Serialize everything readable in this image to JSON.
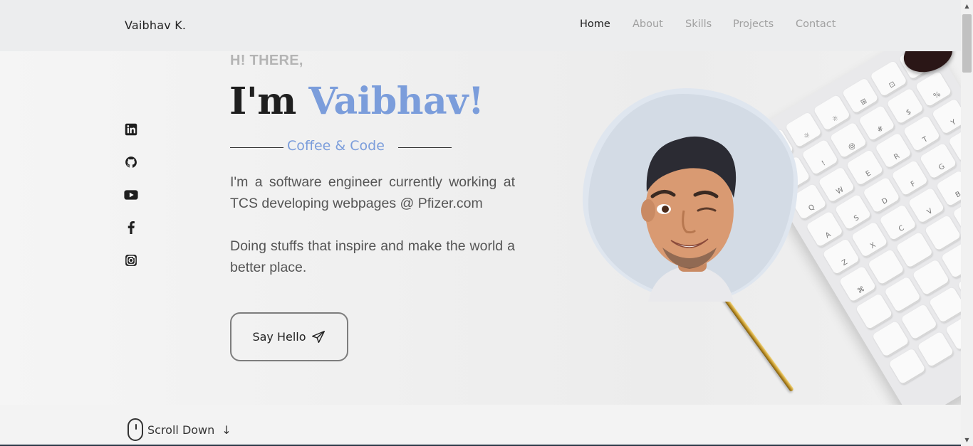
{
  "header": {
    "brand": "Vaibhav K.",
    "nav": [
      {
        "label": "Home",
        "active": true
      },
      {
        "label": "About",
        "active": false
      },
      {
        "label": "Skills",
        "active": false
      },
      {
        "label": "Projects",
        "active": false
      },
      {
        "label": "Contact",
        "active": false
      }
    ]
  },
  "social": [
    "linkedin-icon",
    "github-icon",
    "youtube-icon",
    "facebook-icon",
    "instagram-icon"
  ],
  "hero": {
    "greeting": "H! THERE,",
    "title_prefix": "I'm ",
    "title_name": "Vaibhav!",
    "tagline": "Coffee & Code",
    "paragraph1": "I'm a software engineer currently working at TCS developing webpages @ Pfizer.com",
    "paragraph2": "Doing stuffs that inspire and make the world a better place.",
    "cta_label": "Say Hello"
  },
  "scroll": {
    "label": "Scroll Down"
  },
  "colors": {
    "accent": "#7b9ddb",
    "header_bg": "#ecedee",
    "text": "#1f1f1f",
    "muted": "#a0a0a0"
  }
}
